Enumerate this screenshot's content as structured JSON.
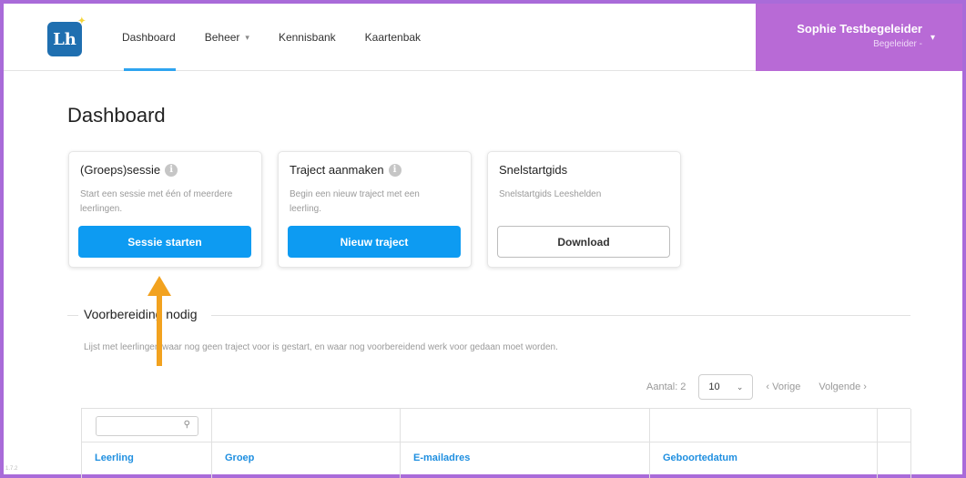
{
  "app": {
    "logo_text": "Lh"
  },
  "nav": {
    "items": [
      {
        "label": "Dashboard",
        "active": true,
        "dropdown": false
      },
      {
        "label": "Beheer",
        "active": false,
        "dropdown": true
      },
      {
        "label": "Kennisbank",
        "active": false,
        "dropdown": false
      },
      {
        "label": "Kaartenbak",
        "active": false,
        "dropdown": false
      }
    ]
  },
  "user": {
    "name": "Sophie Testbegeleider",
    "role": "Begeleider -"
  },
  "page": {
    "title": "Dashboard"
  },
  "cards": [
    {
      "title": "(Groeps)sessie",
      "has_info": true,
      "description": "Start een sessie met één of meerdere leerlingen.",
      "button": "Sessie starten",
      "style": "primary"
    },
    {
      "title": "Traject aanmaken",
      "has_info": true,
      "description": "Begin een nieuw traject met een leerling.",
      "button": "Nieuw traject",
      "style": "primary"
    },
    {
      "title": "Snelstartgids",
      "has_info": false,
      "description": "Snelstartgids Leeshelden",
      "button": "Download",
      "style": "outline"
    }
  ],
  "section": {
    "title": "Voorbereiding nodig",
    "description": "Lijst met leerlingen waar nog geen traject voor is gestart, en waar nog voorbereidend werk voor gedaan moet worden."
  },
  "pager": {
    "count_label": "Aantal: 2",
    "page_size": "10",
    "prev_label": "‹ Vorige",
    "next_label": "Volgende ›"
  },
  "table": {
    "search_value": "",
    "columns": [
      "Leerling",
      "Groep",
      "E-mailadres",
      "Geboortedatum"
    ]
  },
  "version": "1.7.2",
  "colors": {
    "accent": "#0d9bf2",
    "user_bg": "#b86ad6",
    "arrow": "#f2a21f",
    "link": "#1f8fe0"
  }
}
